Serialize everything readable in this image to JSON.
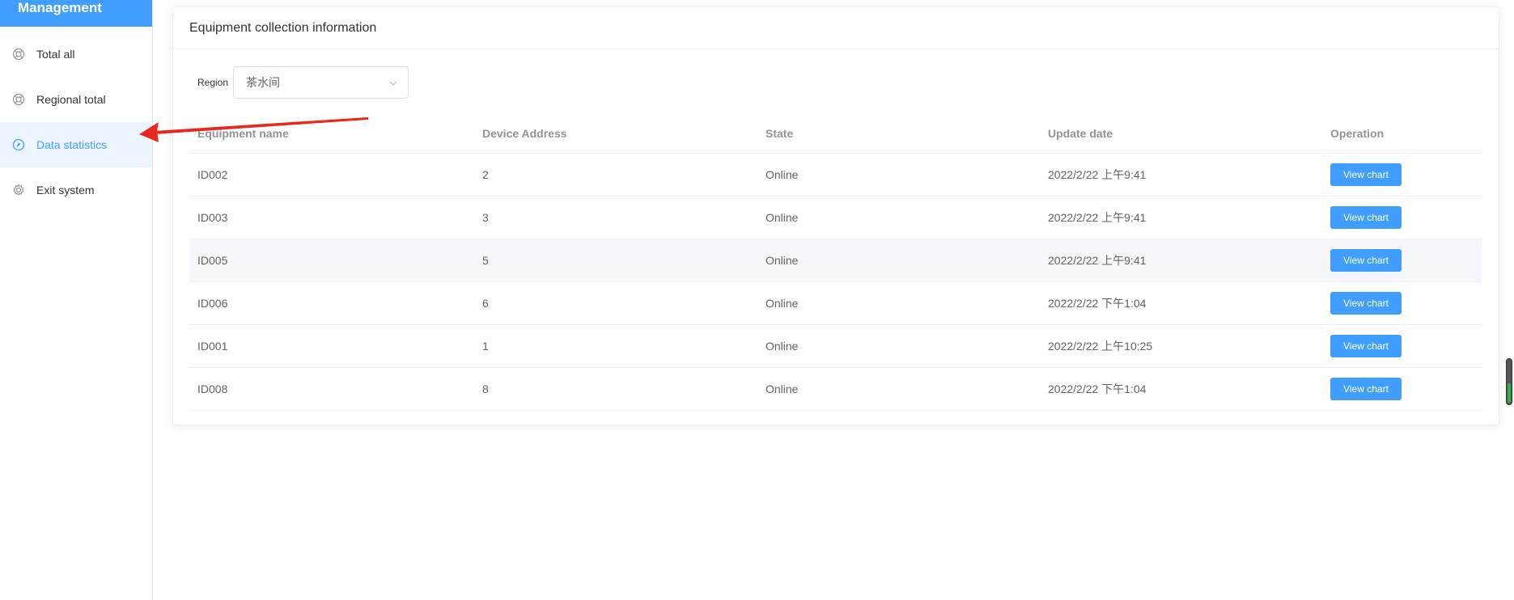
{
  "sidebar": {
    "brand": "Management",
    "items": [
      {
        "label": "Total all",
        "icon": "lifebuoy-icon"
      },
      {
        "label": "Regional total",
        "icon": "lifebuoy-icon"
      },
      {
        "label": "Data statistics",
        "icon": "compass-icon",
        "active": true
      },
      {
        "label": "Exit system",
        "icon": "gear-icon"
      }
    ]
  },
  "card": {
    "title": "Equipment collection information",
    "filter": {
      "label": "Region",
      "value": "茶水间"
    }
  },
  "table": {
    "headers": [
      "Equipment name",
      "Device Address",
      "State",
      "Update date",
      "Operation"
    ],
    "rows": [
      {
        "name": "ID002",
        "address": "2",
        "state": "Online",
        "date": "2022/2/22 上午9:41",
        "action": "View chart"
      },
      {
        "name": "ID003",
        "address": "3",
        "state": "Online",
        "date": "2022/2/22 上午9:41",
        "action": "View chart"
      },
      {
        "name": "ID005",
        "address": "5",
        "state": "Online",
        "date": "2022/2/22 上午9:41",
        "action": "View chart"
      },
      {
        "name": "ID006",
        "address": "6",
        "state": "Online",
        "date": "2022/2/22 下午1:04",
        "action": "View chart"
      },
      {
        "name": "ID001",
        "address": "1",
        "state": "Online",
        "date": "2022/2/22 上午10:25",
        "action": "View chart"
      },
      {
        "name": "ID008",
        "address": "8",
        "state": "Online",
        "date": "2022/2/22 下午1:04",
        "action": "View chart"
      }
    ]
  },
  "colors": {
    "accent": "#409eff",
    "active_bg": "#ecf5ff",
    "annotation_arrow": "#e8281e"
  }
}
